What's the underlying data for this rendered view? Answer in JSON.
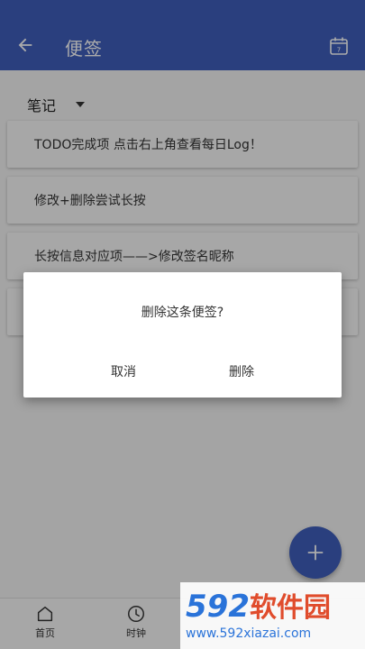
{
  "appbar": {
    "title": "便签"
  },
  "category": {
    "label": "笔记"
  },
  "notes": [
    "TODO完成项 点击右上角查看每日Log！",
    "修改+删除尝试长按",
    "长按信息对应项——>修改签名昵称",
    ""
  ],
  "bottom_nav": [
    {
      "label": "首页",
      "icon": "home-icon"
    },
    {
      "label": "时钟",
      "icon": "clock-icon"
    }
  ],
  "dialog": {
    "message": "删除这条便签?",
    "cancel": "取消",
    "delete": "删除"
  },
  "watermark": {
    "logo_num": "592",
    "logo_text": "软件园",
    "url": "www.592xiazai.com"
  },
  "colors": {
    "primary": "#3f5fbd"
  }
}
